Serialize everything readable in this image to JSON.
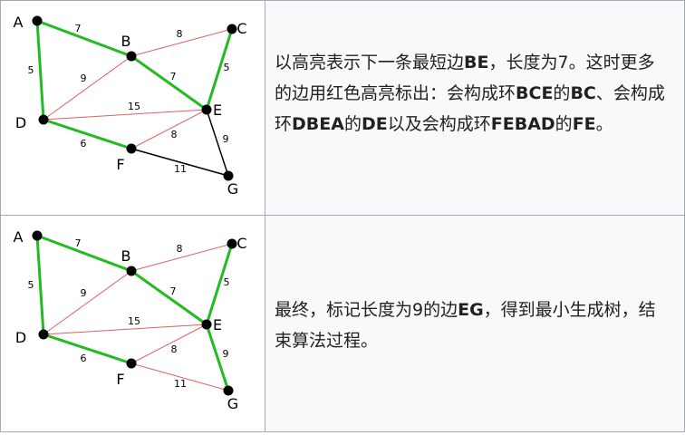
{
  "graph": {
    "nodes": [
      {
        "id": "A"
      },
      {
        "id": "B"
      },
      {
        "id": "C"
      },
      {
        "id": "D"
      },
      {
        "id": "E"
      },
      {
        "id": "F"
      },
      {
        "id": "G"
      }
    ],
    "edges": [
      {
        "u": "A",
        "v": "B",
        "w": "7"
      },
      {
        "u": "A",
        "v": "D",
        "w": "5"
      },
      {
        "u": "B",
        "v": "C",
        "w": "8"
      },
      {
        "u": "B",
        "v": "D",
        "w": "9"
      },
      {
        "u": "B",
        "v": "E",
        "w": "7"
      },
      {
        "u": "C",
        "v": "E",
        "w": "5"
      },
      {
        "u": "D",
        "v": "E",
        "w": "15"
      },
      {
        "u": "D",
        "v": "F",
        "w": "6"
      },
      {
        "u": "E",
        "v": "F",
        "w": "8"
      },
      {
        "u": "E",
        "v": "G",
        "w": "9"
      },
      {
        "u": "F",
        "v": "G",
        "w": "11"
      }
    ],
    "colors": {
      "selected": "#22bb22",
      "rejected": "#e06060",
      "default": "#000000"
    }
  },
  "steps": [
    {
      "edge_state": {
        "A-B": "selected",
        "A-D": "selected",
        "B-C": "rejected",
        "B-D": "rejected",
        "B-E": "selected",
        "C-E": "selected",
        "D-E": "rejected",
        "D-F": "selected",
        "E-F": "rejected",
        "E-G": "default",
        "F-G": "default"
      },
      "text": [
        {
          "t": "以高亮表示下一条最短边",
          "b": false
        },
        {
          "t": "BE",
          "b": true
        },
        {
          "t": "，长度为7。这时更多的边用红色高亮标出：会构成环",
          "b": false
        },
        {
          "t": "BCE",
          "b": true
        },
        {
          "t": "的",
          "b": false
        },
        {
          "t": "BC",
          "b": true
        },
        {
          "t": "、会构成环",
          "b": false
        },
        {
          "t": "DBEA",
          "b": true
        },
        {
          "t": "的",
          "b": false
        },
        {
          "t": "DE",
          "b": true
        },
        {
          "t": "以及会构成环",
          "b": false
        },
        {
          "t": "FEBAD",
          "b": true
        },
        {
          "t": "的",
          "b": false
        },
        {
          "t": "FE",
          "b": true
        },
        {
          "t": "。",
          "b": false
        }
      ]
    },
    {
      "edge_state": {
        "A-B": "selected",
        "A-D": "selected",
        "B-C": "rejected",
        "B-D": "rejected",
        "B-E": "selected",
        "C-E": "selected",
        "D-E": "rejected",
        "D-F": "selected",
        "E-F": "rejected",
        "E-G": "selected",
        "F-G": "rejected"
      },
      "text": [
        {
          "t": "最终，标记长度为9的边",
          "b": false
        },
        {
          "t": "EG",
          "b": true
        },
        {
          "t": "，得到最小生成树，结束算法过程。",
          "b": false
        }
      ]
    }
  ]
}
